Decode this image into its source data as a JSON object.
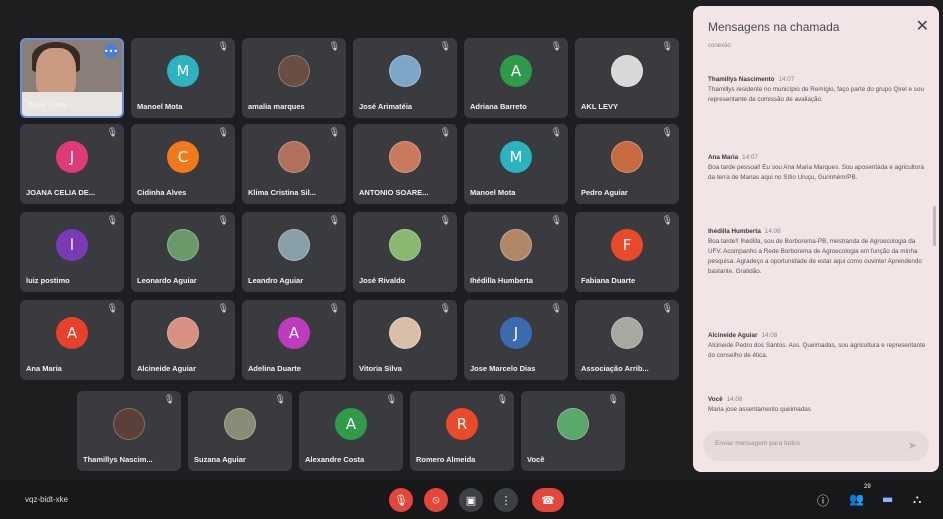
{
  "meeting_code": "vqz-bidt-xke",
  "participants": [
    {
      "name": "Aline Lima",
      "initial": "",
      "color": "#8a7f78",
      "kind": "self-video"
    },
    {
      "name": "Manoel Mota",
      "initial": "M",
      "color": "#2bb3c0",
      "kind": "letter"
    },
    {
      "name": "amalia marques",
      "initial": "",
      "color": "#6a4e44",
      "kind": "photo"
    },
    {
      "name": "José Arimatéia",
      "initial": "",
      "color": "#7ea6c8",
      "kind": "photo"
    },
    {
      "name": "Adriana Barreto",
      "initial": "A",
      "color": "#2e9b4a",
      "kind": "letter"
    },
    {
      "name": "AKL LEVY",
      "initial": "",
      "color": "#d8d8d8",
      "kind": "photo"
    },
    {
      "name": "JOANA CELIA DE...",
      "initial": "J",
      "color": "#e03a7a",
      "kind": "letter"
    },
    {
      "name": "Cidinha Alves",
      "initial": "C",
      "color": "#f07a1a",
      "kind": "letter"
    },
    {
      "name": "Klima Cristina Sil...",
      "initial": "",
      "color": "#b0705a",
      "kind": "photo"
    },
    {
      "name": "ANTONIO SOARE...",
      "initial": "",
      "color": "#c87a5a",
      "kind": "photo"
    },
    {
      "name": "Manoel Mota",
      "initial": "M",
      "color": "#2bb3c0",
      "kind": "letter"
    },
    {
      "name": "Pedro Aguiar",
      "initial": "",
      "color": "#c86a40",
      "kind": "photo"
    },
    {
      "name": "luiz postimo",
      "initial": "l",
      "color": "#7a3ab8",
      "kind": "letter"
    },
    {
      "name": "Leonardo Aguiar",
      "initial": "",
      "color": "#6a9a6a",
      "kind": "photo"
    },
    {
      "name": "Leandro Aguiar",
      "initial": "",
      "color": "#8aa0a8",
      "kind": "photo"
    },
    {
      "name": "José Rivaldo",
      "initial": "",
      "color": "#8ab870",
      "kind": "photo"
    },
    {
      "name": "Ihédilla Humberta",
      "initial": "",
      "color": "#b08868",
      "kind": "photo"
    },
    {
      "name": "Fabiana Duarte",
      "initial": "F",
      "color": "#e84a2a",
      "kind": "letter"
    },
    {
      "name": "Ana Maria",
      "initial": "A",
      "color": "#e8402a",
      "kind": "letter"
    },
    {
      "name": "Alcineide Aguiar",
      "initial": "",
      "color": "#d89080",
      "kind": "photo"
    },
    {
      "name": "Adelina Duarte",
      "initial": "A",
      "color": "#c03ac0",
      "kind": "letter"
    },
    {
      "name": "Vitoria Silva",
      "initial": "",
      "color": "#d8c0a8",
      "kind": "photo"
    },
    {
      "name": "Jose Marcelo Dias",
      "initial": "J",
      "color": "#3a6ab0",
      "kind": "letter"
    },
    {
      "name": "Associação Arrib...",
      "initial": "",
      "color": "#a8a8a0",
      "kind": "photo"
    },
    {
      "name": "Thamillys Nascim...",
      "initial": "",
      "color": "#5a4038",
      "kind": "photo"
    },
    {
      "name": "Suzana Aguiar",
      "initial": "",
      "color": "#8a8a78",
      "kind": "photo"
    },
    {
      "name": "Alexandre Costa",
      "initial": "A",
      "color": "#2e9b4a",
      "kind": "letter"
    },
    {
      "name": "Romero Almeida",
      "initial": "R",
      "color": "#e84a2a",
      "kind": "letter"
    },
    {
      "name": "Você",
      "initial": "",
      "color": "#5aa86a",
      "kind": "photo"
    }
  ],
  "chat": {
    "title": "Mensagens na chamada",
    "subtitle": "conexão",
    "messages": [
      {
        "author": "Thamillys Nascimento",
        "time": "14:07",
        "text": "Thamillys residente no município de Remígio, faço parte do grupo Qirel e sou representante da comissão de avaliação."
      },
      {
        "author": "Ana Maria",
        "time": "14:07",
        "text": "Boa tarde pessoal! Eu sou Ana Maria Marques. Sou aposentada e agricultora da terra de Manas aqui no Sítio Uruçu, Gurinhém/PB."
      },
      {
        "author": "Ihédilla Humberta",
        "time": "14:08",
        "text": "Boa tarde!! Ihédilla, sou de Borborema-PB, mestranda de Agroecologia da UFV. Acompanho a Rede Borborema de Agroecologia em função da minha pesquisa. Agradeço a oportunidade de estar aqui como ouvinte! Aprendendo bastante. Gratidão."
      },
      {
        "author": "Alcineide Aguiar",
        "time": "14:08",
        "text": "Alcineide Pedro dos Santos. Ass. Queimadas, sou agricultura e representante do conselho de ética."
      },
      {
        "author": "Você",
        "time": "14:08",
        "text": "Maria jose assentamento queimadas"
      }
    ],
    "input_placeholder": "Enviar mensagem para todos"
  },
  "participants_count": "29"
}
